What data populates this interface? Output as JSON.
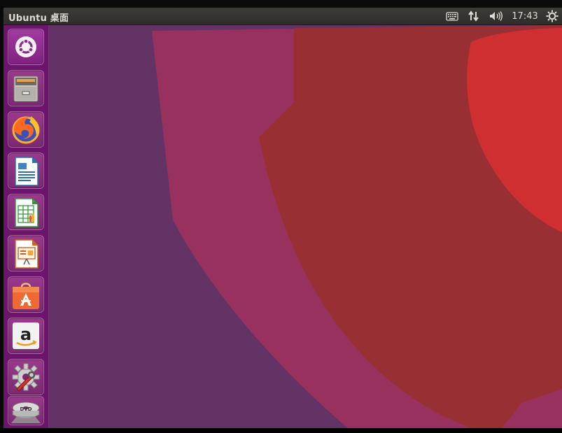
{
  "top_panel": {
    "title": "Ubuntu 桌面",
    "clock": "17:43",
    "indicators": [
      "keyboard-icon",
      "network-icon",
      "volume-icon",
      "system-settings-icon"
    ]
  },
  "launcher": {
    "items": [
      {
        "name": "ubuntu-dash",
        "icon": "ubuntu-logo-icon"
      },
      {
        "name": "files",
        "icon": "file-cabinet-icon"
      },
      {
        "name": "firefox",
        "icon": "firefox-icon"
      },
      {
        "name": "libreoffice-writer",
        "icon": "writer-document-icon"
      },
      {
        "name": "libreoffice-calc",
        "icon": "calc-spreadsheet-icon"
      },
      {
        "name": "libreoffice-impress",
        "icon": "impress-presentation-icon"
      },
      {
        "name": "ubuntu-software",
        "icon": "software-bag-icon"
      },
      {
        "name": "amazon",
        "icon": "amazon-icon"
      },
      {
        "name": "system-settings",
        "icon": "settings-wrench-icon"
      },
      {
        "name": "dvd",
        "icon": "dvd-icon"
      }
    ]
  },
  "colors": {
    "launcher": "#6e126e",
    "wallpaper_purple": "#633365",
    "wallpaper_magenta": "#99315f",
    "wallpaper_red": "#982f32",
    "wallpaper_bright_red": "#cf2f30",
    "panel": "#3c3b37"
  }
}
